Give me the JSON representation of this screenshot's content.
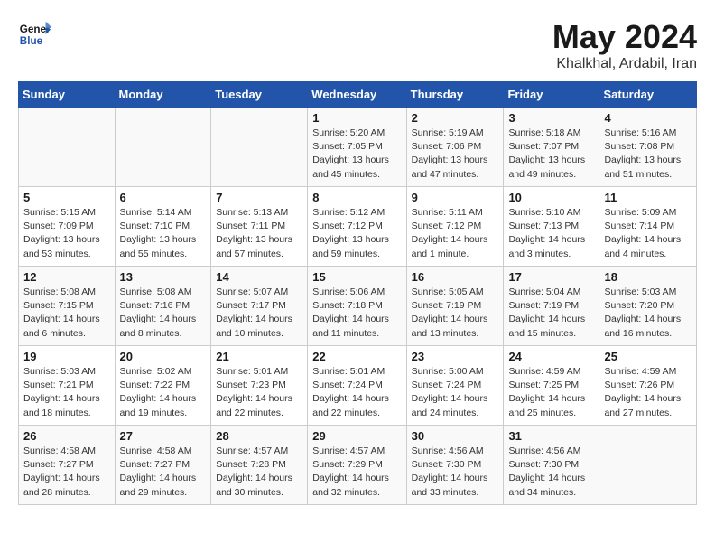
{
  "header": {
    "logo_line1": "General",
    "logo_line2": "Blue",
    "month": "May 2024",
    "location": "Khalkhal, Ardabil, Iran"
  },
  "weekdays": [
    "Sunday",
    "Monday",
    "Tuesday",
    "Wednesday",
    "Thursday",
    "Friday",
    "Saturday"
  ],
  "weeks": [
    [
      {
        "day": "",
        "sunrise": "",
        "sunset": "",
        "daylight": ""
      },
      {
        "day": "",
        "sunrise": "",
        "sunset": "",
        "daylight": ""
      },
      {
        "day": "",
        "sunrise": "",
        "sunset": "",
        "daylight": ""
      },
      {
        "day": "1",
        "sunrise": "Sunrise: 5:20 AM",
        "sunset": "Sunset: 7:05 PM",
        "daylight": "Daylight: 13 hours and 45 minutes."
      },
      {
        "day": "2",
        "sunrise": "Sunrise: 5:19 AM",
        "sunset": "Sunset: 7:06 PM",
        "daylight": "Daylight: 13 hours and 47 minutes."
      },
      {
        "day": "3",
        "sunrise": "Sunrise: 5:18 AM",
        "sunset": "Sunset: 7:07 PM",
        "daylight": "Daylight: 13 hours and 49 minutes."
      },
      {
        "day": "4",
        "sunrise": "Sunrise: 5:16 AM",
        "sunset": "Sunset: 7:08 PM",
        "daylight": "Daylight: 13 hours and 51 minutes."
      }
    ],
    [
      {
        "day": "5",
        "sunrise": "Sunrise: 5:15 AM",
        "sunset": "Sunset: 7:09 PM",
        "daylight": "Daylight: 13 hours and 53 minutes."
      },
      {
        "day": "6",
        "sunrise": "Sunrise: 5:14 AM",
        "sunset": "Sunset: 7:10 PM",
        "daylight": "Daylight: 13 hours and 55 minutes."
      },
      {
        "day": "7",
        "sunrise": "Sunrise: 5:13 AM",
        "sunset": "Sunset: 7:11 PM",
        "daylight": "Daylight: 13 hours and 57 minutes."
      },
      {
        "day": "8",
        "sunrise": "Sunrise: 5:12 AM",
        "sunset": "Sunset: 7:12 PM",
        "daylight": "Daylight: 13 hours and 59 minutes."
      },
      {
        "day": "9",
        "sunrise": "Sunrise: 5:11 AM",
        "sunset": "Sunset: 7:12 PM",
        "daylight": "Daylight: 14 hours and 1 minute."
      },
      {
        "day": "10",
        "sunrise": "Sunrise: 5:10 AM",
        "sunset": "Sunset: 7:13 PM",
        "daylight": "Daylight: 14 hours and 3 minutes."
      },
      {
        "day": "11",
        "sunrise": "Sunrise: 5:09 AM",
        "sunset": "Sunset: 7:14 PM",
        "daylight": "Daylight: 14 hours and 4 minutes."
      }
    ],
    [
      {
        "day": "12",
        "sunrise": "Sunrise: 5:08 AM",
        "sunset": "Sunset: 7:15 PM",
        "daylight": "Daylight: 14 hours and 6 minutes."
      },
      {
        "day": "13",
        "sunrise": "Sunrise: 5:08 AM",
        "sunset": "Sunset: 7:16 PM",
        "daylight": "Daylight: 14 hours and 8 minutes."
      },
      {
        "day": "14",
        "sunrise": "Sunrise: 5:07 AM",
        "sunset": "Sunset: 7:17 PM",
        "daylight": "Daylight: 14 hours and 10 minutes."
      },
      {
        "day": "15",
        "sunrise": "Sunrise: 5:06 AM",
        "sunset": "Sunset: 7:18 PM",
        "daylight": "Daylight: 14 hours and 11 minutes."
      },
      {
        "day": "16",
        "sunrise": "Sunrise: 5:05 AM",
        "sunset": "Sunset: 7:19 PM",
        "daylight": "Daylight: 14 hours and 13 minutes."
      },
      {
        "day": "17",
        "sunrise": "Sunrise: 5:04 AM",
        "sunset": "Sunset: 7:19 PM",
        "daylight": "Daylight: 14 hours and 15 minutes."
      },
      {
        "day": "18",
        "sunrise": "Sunrise: 5:03 AM",
        "sunset": "Sunset: 7:20 PM",
        "daylight": "Daylight: 14 hours and 16 minutes."
      }
    ],
    [
      {
        "day": "19",
        "sunrise": "Sunrise: 5:03 AM",
        "sunset": "Sunset: 7:21 PM",
        "daylight": "Daylight: 14 hours and 18 minutes."
      },
      {
        "day": "20",
        "sunrise": "Sunrise: 5:02 AM",
        "sunset": "Sunset: 7:22 PM",
        "daylight": "Daylight: 14 hours and 19 minutes."
      },
      {
        "day": "21",
        "sunrise": "Sunrise: 5:01 AM",
        "sunset": "Sunset: 7:23 PM",
        "daylight": "Daylight: 14 hours and 22 minutes."
      },
      {
        "day": "22",
        "sunrise": "Sunrise: 5:01 AM",
        "sunset": "Sunset: 7:24 PM",
        "daylight": "Daylight: 14 hours and 22 minutes."
      },
      {
        "day": "23",
        "sunrise": "Sunrise: 5:00 AM",
        "sunset": "Sunset: 7:24 PM",
        "daylight": "Daylight: 14 hours and 24 minutes."
      },
      {
        "day": "24",
        "sunrise": "Sunrise: 4:59 AM",
        "sunset": "Sunset: 7:25 PM",
        "daylight": "Daylight: 14 hours and 25 minutes."
      },
      {
        "day": "25",
        "sunrise": "Sunrise: 4:59 AM",
        "sunset": "Sunset: 7:26 PM",
        "daylight": "Daylight: 14 hours and 27 minutes."
      }
    ],
    [
      {
        "day": "26",
        "sunrise": "Sunrise: 4:58 AM",
        "sunset": "Sunset: 7:27 PM",
        "daylight": "Daylight: 14 hours and 28 minutes."
      },
      {
        "day": "27",
        "sunrise": "Sunrise: 4:58 AM",
        "sunset": "Sunset: 7:27 PM",
        "daylight": "Daylight: 14 hours and 29 minutes."
      },
      {
        "day": "28",
        "sunrise": "Sunrise: 4:57 AM",
        "sunset": "Sunset: 7:28 PM",
        "daylight": "Daylight: 14 hours and 30 minutes."
      },
      {
        "day": "29",
        "sunrise": "Sunrise: 4:57 AM",
        "sunset": "Sunset: 7:29 PM",
        "daylight": "Daylight: 14 hours and 32 minutes."
      },
      {
        "day": "30",
        "sunrise": "Sunrise: 4:56 AM",
        "sunset": "Sunset: 7:30 PM",
        "daylight": "Daylight: 14 hours and 33 minutes."
      },
      {
        "day": "31",
        "sunrise": "Sunrise: 4:56 AM",
        "sunset": "Sunset: 7:30 PM",
        "daylight": "Daylight: 14 hours and 34 minutes."
      },
      {
        "day": "",
        "sunrise": "",
        "sunset": "",
        "daylight": ""
      }
    ]
  ]
}
